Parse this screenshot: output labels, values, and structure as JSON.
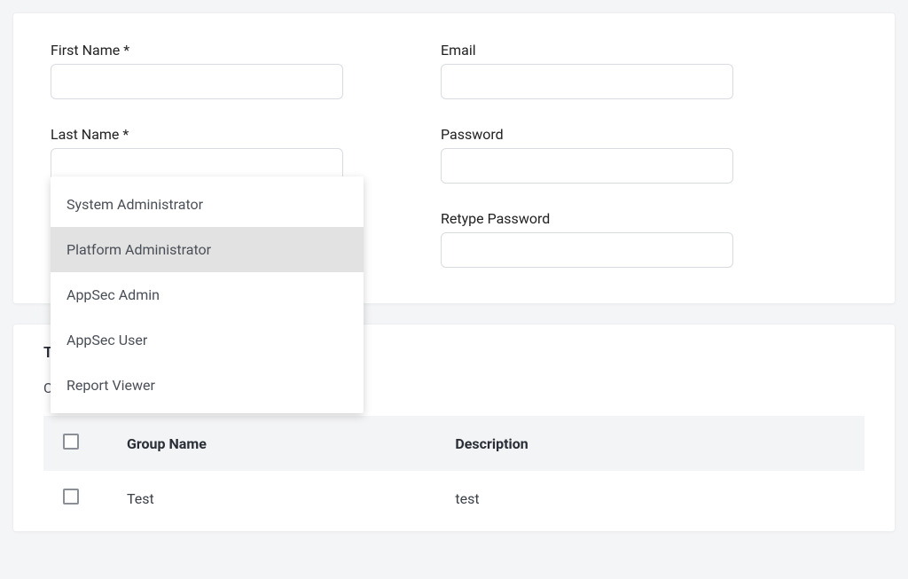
{
  "form": {
    "first_name_label": "First Name *",
    "first_name_value": "",
    "last_name_label": "Last Name *",
    "last_name_value": "",
    "email_label": "Email",
    "email_value": "",
    "password_label": "Password",
    "password_value": "",
    "retype_password_label": "Retype Password",
    "retype_password_value": ""
  },
  "role_dropdown": {
    "options": [
      "System Administrator",
      "Platform Administrator",
      "AppSec Admin",
      "AppSec User",
      "Report Viewer"
    ],
    "selected_index": 1
  },
  "groups": {
    "section_title": "Target Groups",
    "subtitle": "Configure Target Groups Access:",
    "columns": {
      "name": "Group Name",
      "description": "Description"
    },
    "rows": [
      {
        "name": "Test",
        "description": "test"
      }
    ]
  }
}
